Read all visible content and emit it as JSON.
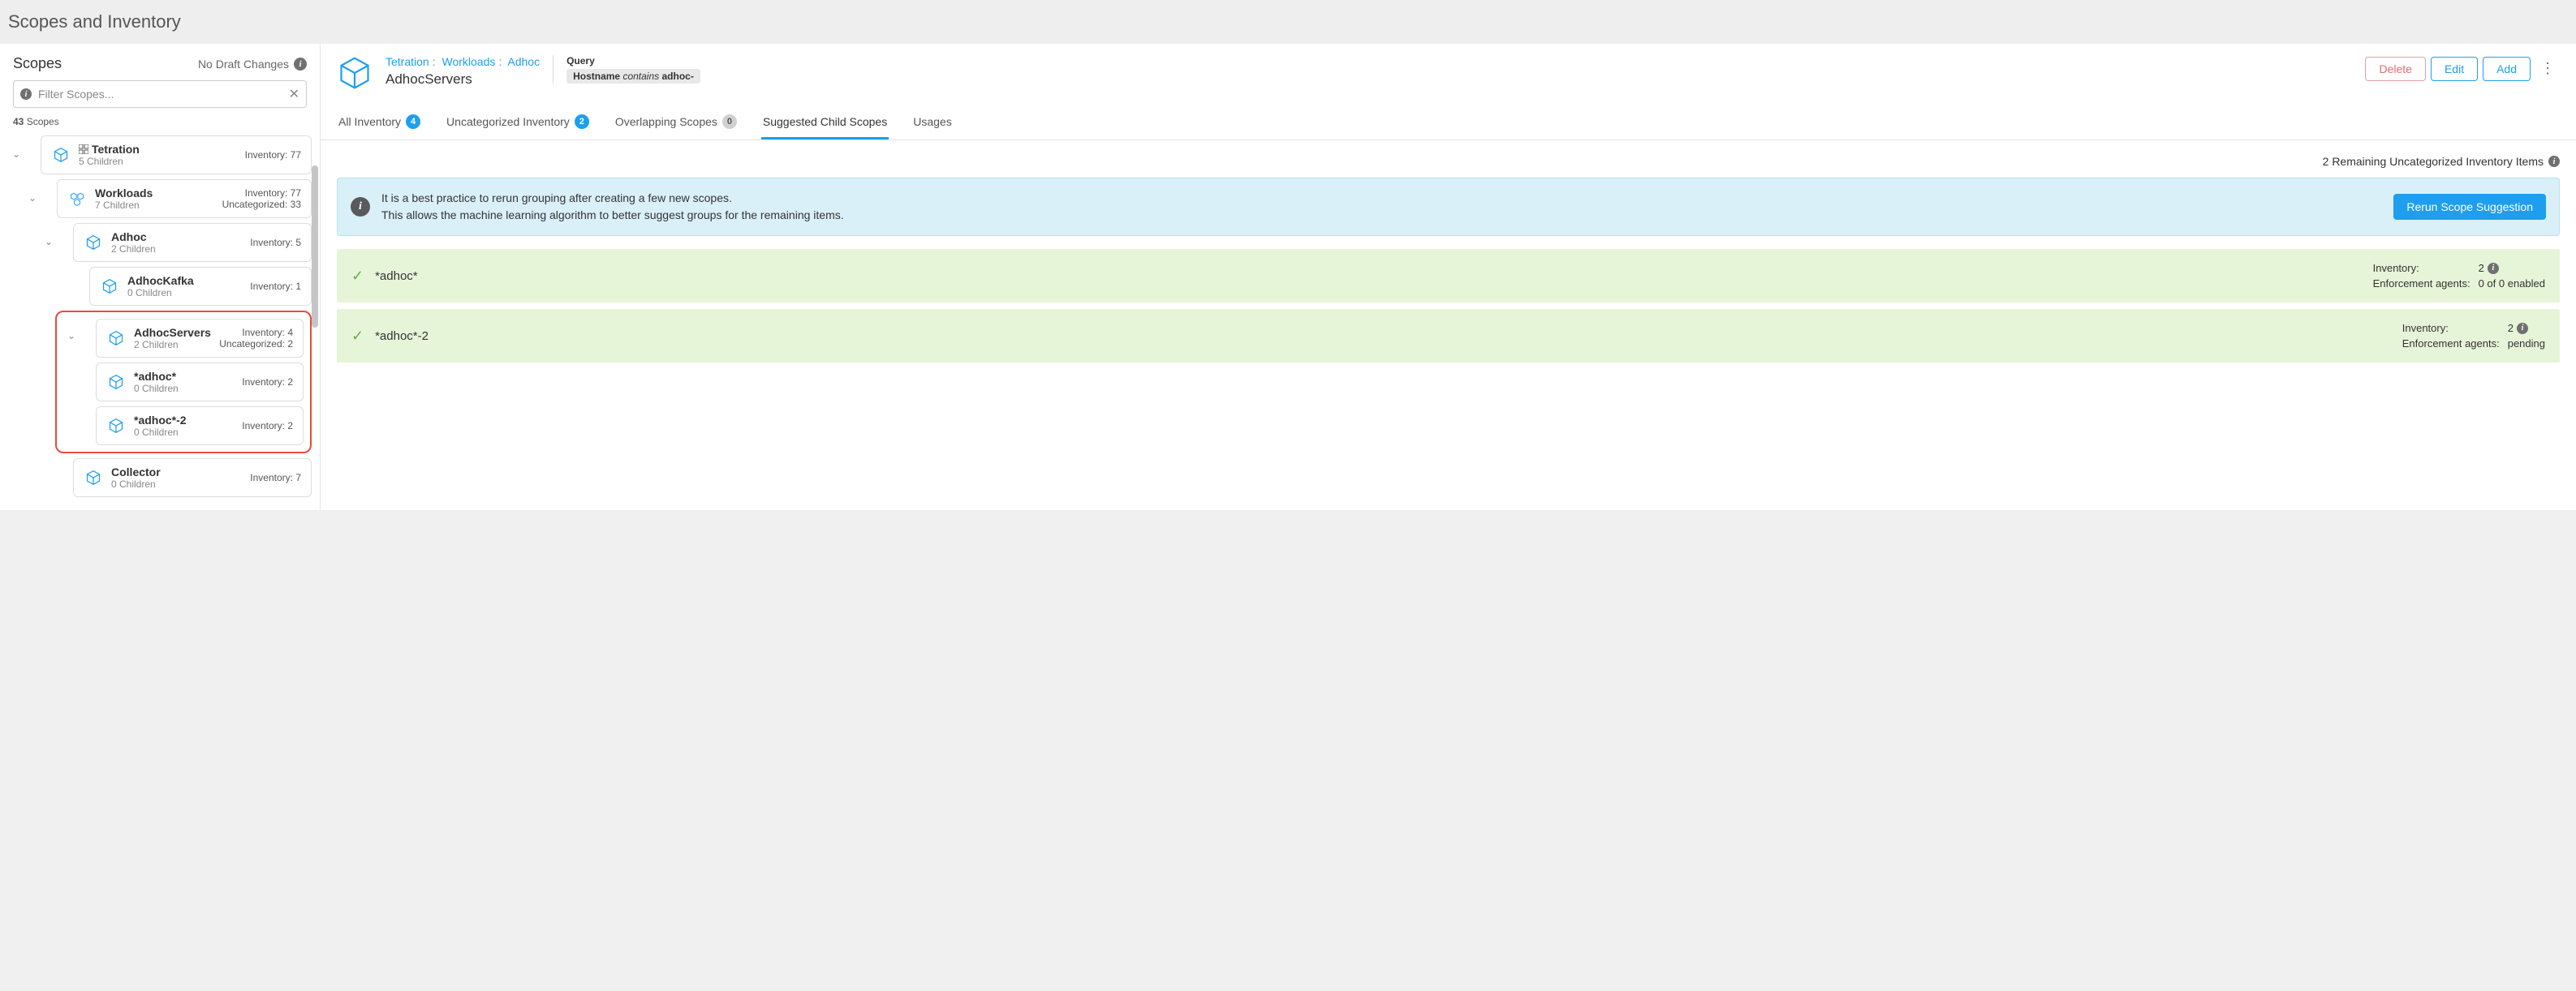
{
  "page_title": "Scopes and Inventory",
  "sidebar": {
    "title": "Scopes",
    "draft_status": "No Draft Changes",
    "filter_placeholder": "Filter Scopes...",
    "scope_count_value": "43",
    "scope_count_label": "Scopes"
  },
  "tree": {
    "tetration": {
      "name": "Tetration",
      "children": "5 Children",
      "inventory": "Inventory: 77"
    },
    "workloads": {
      "name": "Workloads",
      "children": "7 Children",
      "inventory": "Inventory: 77",
      "uncategorized": "Uncategorized: 33"
    },
    "adhoc": {
      "name": "Adhoc",
      "children": "2 Children",
      "inventory": "Inventory: 5"
    },
    "adhockafka": {
      "name": "AdhocKafka",
      "children": "0 Children",
      "inventory": "Inventory: 1"
    },
    "adhocservers": {
      "name": "AdhocServers",
      "children": "2 Children",
      "inventory": "Inventory: 4",
      "uncategorized": "Uncategorized: 2"
    },
    "adhoc1": {
      "name": "*adhoc*",
      "children": "0 Children",
      "inventory": "Inventory: 2"
    },
    "adhoc2": {
      "name": "*adhoc*-2",
      "children": "0 Children",
      "inventory": "Inventory: 2"
    },
    "collector": {
      "name": "Collector",
      "children": "0 Children",
      "inventory": "Inventory: 7"
    }
  },
  "header": {
    "breadcrumb": {
      "tetration": "Tetration",
      "workloads": "Workloads",
      "adhoc": "Adhoc"
    },
    "scope_name": "AdhocServers",
    "query_label": "Query",
    "query_field": "Hostname",
    "query_op": "contains",
    "query_value": "adhoc-",
    "actions": {
      "delete": "Delete",
      "edit": "Edit",
      "add": "Add"
    }
  },
  "tabs": {
    "all_inventory": "All Inventory",
    "all_inventory_count": "4",
    "uncategorized": "Uncategorized Inventory",
    "uncategorized_count": "2",
    "overlapping": "Overlapping Scopes",
    "overlapping_count": "0",
    "suggested": "Suggested Child Scopes",
    "usages": "Usages"
  },
  "body": {
    "remaining": "2 Remaining Uncategorized Inventory Items",
    "alert_line1": "It is a best practice to rerun grouping after creating a few new scopes.",
    "alert_line2": "This allows the machine learning algorithm to better suggest groups for the remaining items.",
    "rerun_btn": "Rerun Scope Suggestion",
    "suggestions": [
      {
        "name": "*adhoc*",
        "inventory_label": "Inventory:",
        "inventory_val": "2",
        "agents_label": "Enforcement agents:",
        "agents_val": "0 of 0 enabled"
      },
      {
        "name": "*adhoc*-2",
        "inventory_label": "Inventory:",
        "inventory_val": "2",
        "agents_label": "Enforcement agents:",
        "agents_val": "pending"
      }
    ]
  }
}
